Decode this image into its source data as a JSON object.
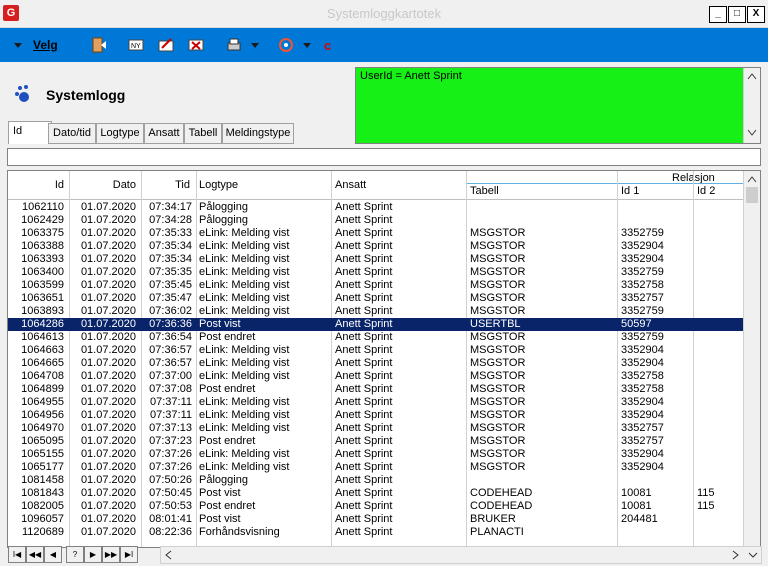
{
  "window": {
    "title": "Systemloggkartotek",
    "app_icon": "G",
    "min": "_",
    "max": "□",
    "close": "X"
  },
  "toolbar": {
    "velg_label": "Velg",
    "icons": [
      "menu-arrow-icon",
      "exit-door-icon",
      "new-icon",
      "edit-icon",
      "delete-icon",
      "print-icon",
      "tools-icon",
      "refresh-icon"
    ]
  },
  "header": {
    "title": "Systemlogg"
  },
  "infobox": {
    "text": "UserId = Anett Sprint"
  },
  "tabs": [
    {
      "label": "Id"
    },
    {
      "label": "Dato/tid"
    },
    {
      "label": "Logtype"
    },
    {
      "label": "Ansatt"
    },
    {
      "label": "Tabell"
    },
    {
      "label": "Meldingstype"
    }
  ],
  "filter": {
    "value": ""
  },
  "grid": {
    "columns": {
      "id": "Id",
      "dato": "Dato",
      "tid": "Tid",
      "logtype": "Logtype",
      "ansatt": "Ansatt",
      "relasjon": "Relasjon",
      "tabell": "Tabell",
      "id1": "Id 1",
      "id2": "Id 2"
    },
    "rows": [
      [
        "1062110",
        "01.07.2020",
        "07:34:17",
        "Pålogging",
        "Anett Sprint",
        "",
        "",
        ""
      ],
      [
        "1062429",
        "01.07.2020",
        "07:34:28",
        "Pålogging",
        "Anett Sprint",
        "",
        "",
        ""
      ],
      [
        "1063375",
        "01.07.2020",
        "07:35:33",
        "eLink: Melding vist",
        "Anett Sprint",
        "MSGSTOR",
        "3352759",
        ""
      ],
      [
        "1063388",
        "01.07.2020",
        "07:35:34",
        "eLink: Melding vist",
        "Anett Sprint",
        "MSGSTOR",
        "3352904",
        ""
      ],
      [
        "1063393",
        "01.07.2020",
        "07:35:34",
        "eLink: Melding vist",
        "Anett Sprint",
        "MSGSTOR",
        "3352904",
        ""
      ],
      [
        "1063400",
        "01.07.2020",
        "07:35:35",
        "eLink: Melding vist",
        "Anett Sprint",
        "MSGSTOR",
        "3352759",
        ""
      ],
      [
        "1063599",
        "01.07.2020",
        "07:35:45",
        "eLink: Melding vist",
        "Anett Sprint",
        "MSGSTOR",
        "3352758",
        ""
      ],
      [
        "1063651",
        "01.07.2020",
        "07:35:47",
        "eLink: Melding vist",
        "Anett Sprint",
        "MSGSTOR",
        "3352757",
        ""
      ],
      [
        "1063893",
        "01.07.2020",
        "07:36:02",
        "eLink: Melding vist",
        "Anett Sprint",
        "MSGSTOR",
        "3352759",
        ""
      ],
      [
        "1064286",
        "01.07.2020",
        "07:36:36",
        "Post vist",
        "Anett Sprint",
        "USERTBL",
        "50597",
        ""
      ],
      [
        "1064613",
        "01.07.2020",
        "07:36:54",
        "Post endret",
        "Anett Sprint",
        "MSGSTOR",
        "3352759",
        ""
      ],
      [
        "1064663",
        "01.07.2020",
        "07:36:57",
        "eLink: Melding vist",
        "Anett Sprint",
        "MSGSTOR",
        "3352904",
        ""
      ],
      [
        "1064665",
        "01.07.2020",
        "07:36:57",
        "eLink: Melding vist",
        "Anett Sprint",
        "MSGSTOR",
        "3352904",
        ""
      ],
      [
        "1064708",
        "01.07.2020",
        "07:37:00",
        "eLink: Melding vist",
        "Anett Sprint",
        "MSGSTOR",
        "3352758",
        ""
      ],
      [
        "1064899",
        "01.07.2020",
        "07:37:08",
        "Post endret",
        "Anett Sprint",
        "MSGSTOR",
        "3352758",
        ""
      ],
      [
        "1064955",
        "01.07.2020",
        "07:37:11",
        "eLink: Melding vist",
        "Anett Sprint",
        "MSGSTOR",
        "3352904",
        ""
      ],
      [
        "1064956",
        "01.07.2020",
        "07:37:11",
        "eLink: Melding vist",
        "Anett Sprint",
        "MSGSTOR",
        "3352904",
        ""
      ],
      [
        "1064970",
        "01.07.2020",
        "07:37:13",
        "eLink: Melding vist",
        "Anett Sprint",
        "MSGSTOR",
        "3352757",
        ""
      ],
      [
        "1065095",
        "01.07.2020",
        "07:37:23",
        "Post endret",
        "Anett Sprint",
        "MSGSTOR",
        "3352757",
        ""
      ],
      [
        "1065155",
        "01.07.2020",
        "07:37:26",
        "eLink: Melding vist",
        "Anett Sprint",
        "MSGSTOR",
        "3352904",
        ""
      ],
      [
        "1065177",
        "01.07.2020",
        "07:37:26",
        "eLink: Melding vist",
        "Anett Sprint",
        "MSGSTOR",
        "3352904",
        ""
      ],
      [
        "1081458",
        "01.07.2020",
        "07:50:26",
        "Pålogging",
        "Anett Sprint",
        "",
        "",
        ""
      ],
      [
        "1081843",
        "01.07.2020",
        "07:50:45",
        "Post vist",
        "Anett Sprint",
        "CODEHEAD",
        "10081",
        "115"
      ],
      [
        "1082005",
        "01.07.2020",
        "07:50:53",
        "Post endret",
        "Anett Sprint",
        "CODEHEAD",
        "10081",
        "115"
      ],
      [
        "1096057",
        "01.07.2020",
        "08:01:41",
        "Post vist",
        "Anett Sprint",
        "BRUKER",
        "204481",
        ""
      ],
      [
        "1120689",
        "01.07.2020",
        "08:22:36",
        "Forhåndsvisning",
        "Anett Sprint",
        "PLANACTI",
        "",
        ""
      ]
    ],
    "selected_row": 9
  },
  "navigator": {
    "buttons": [
      "I◀",
      "◀◀",
      "◀",
      "?",
      "▶",
      "▶▶",
      "▶I"
    ]
  },
  "colors": {
    "toolbar": "#0078d7",
    "infobox": "#17f017",
    "selection": "#0a246a"
  }
}
